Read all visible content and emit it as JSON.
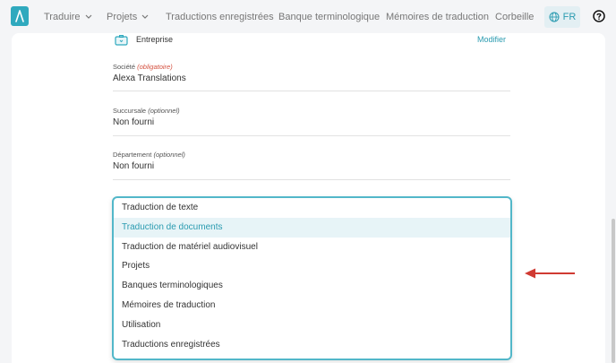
{
  "nav": {
    "items": [
      {
        "label": "Traduire",
        "has_dropdown": true
      },
      {
        "label": "Projets",
        "has_dropdown": true
      },
      {
        "label": "Traductions enregistrées",
        "has_dropdown": false
      },
      {
        "label": "Banque terminologique",
        "has_dropdown": false
      },
      {
        "label": "Mémoires de traduction",
        "has_dropdown": false
      },
      {
        "label": "Corbeille",
        "has_dropdown": false
      }
    ],
    "language": "FR"
  },
  "section": {
    "title": "Entreprise",
    "modify_label": "Modifier"
  },
  "fields": [
    {
      "label": "Société",
      "qualifier": "(obligatoire)",
      "value": "Alexa Translations"
    },
    {
      "label": "Succursale",
      "qualifier": "(optionnel)",
      "value": "Non fourni"
    },
    {
      "label": "Département",
      "qualifier": "(optionnel)",
      "value": "Non fourni"
    }
  ],
  "dropdown": {
    "options": [
      "Traduction de texte",
      "Traduction de documents",
      "Traduction de matériel audiovisuel",
      "Projets",
      "Banques terminologiques",
      "Mémoires de traduction",
      "Utilisation",
      "Traductions enregistrées"
    ],
    "highlighted_option": "Traduction de documents"
  },
  "colors": {
    "accent": "#2fa9be",
    "link": "#2a9bb0",
    "required": "#d4503f",
    "annotation_arrow": "#d03a32"
  }
}
